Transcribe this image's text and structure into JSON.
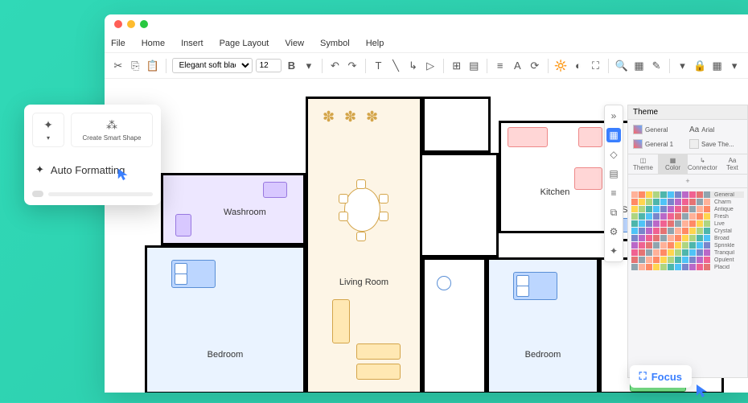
{
  "menubar": {
    "file": "File",
    "home": "Home",
    "insert": "Insert",
    "page_layout": "Page Layout",
    "view": "View",
    "symbol": "Symbol",
    "help": "Help"
  },
  "toolbar": {
    "font": "Elegant soft black",
    "size": "12"
  },
  "rooms": {
    "living": "Living Room",
    "kitchen": "Kitchen",
    "study": "Study",
    "washroom": "Washroom",
    "bedroom": "Bedroom"
  },
  "popup": {
    "create_smart": "Create Smart Shape",
    "auto_fmt": "Auto Formatting"
  },
  "theme": {
    "title": "Theme",
    "items": [
      "General",
      "Arial",
      "General 1",
      "Save The..."
    ],
    "tabs": [
      "Theme",
      "Color",
      "Connector",
      "Text"
    ],
    "palettes": [
      "General",
      "Charm",
      "Antique",
      "Fresh",
      "Live",
      "Crystal",
      "Broad",
      "Sprinkle",
      "Tranquil",
      "Opulent",
      "Placid"
    ]
  },
  "focus": {
    "label": "Focus"
  }
}
